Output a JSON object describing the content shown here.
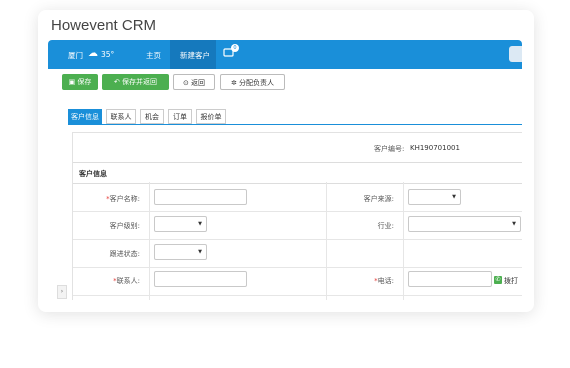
{
  "app": {
    "title": "Howevent CRM"
  },
  "nav": {
    "city": "厦门",
    "temperature": "35°",
    "home": "主页",
    "new_customer": "新建客户",
    "badge_count": "0"
  },
  "toolbar": {
    "save": "保存",
    "save_return": "保存并返回",
    "back": "返回",
    "assign": "分配负责人"
  },
  "tabs": [
    "客户信息",
    "联系人",
    "机会",
    "订单",
    "报价单"
  ],
  "form": {
    "customer_no_label": "客户编号:",
    "customer_no": "KH190701001",
    "section_title": "客户信息",
    "name_label": "客户名称:",
    "source_label": "客户来源:",
    "level_label": "客户级别:",
    "industry_label": "行业:",
    "followup_label": "跟进状态:",
    "contact_label": "联系人:",
    "phone_label": "电话:",
    "dial": "拨打",
    "required_mark": "*"
  },
  "colors": {
    "nav": "#1a8fd9",
    "green": "#4caf50"
  },
  "icons": {
    "weather": "cloud-icon",
    "message": "message-icon",
    "save": "save-icon",
    "back": "back-icon",
    "assign": "gear-icon",
    "phone": "phone-icon"
  }
}
